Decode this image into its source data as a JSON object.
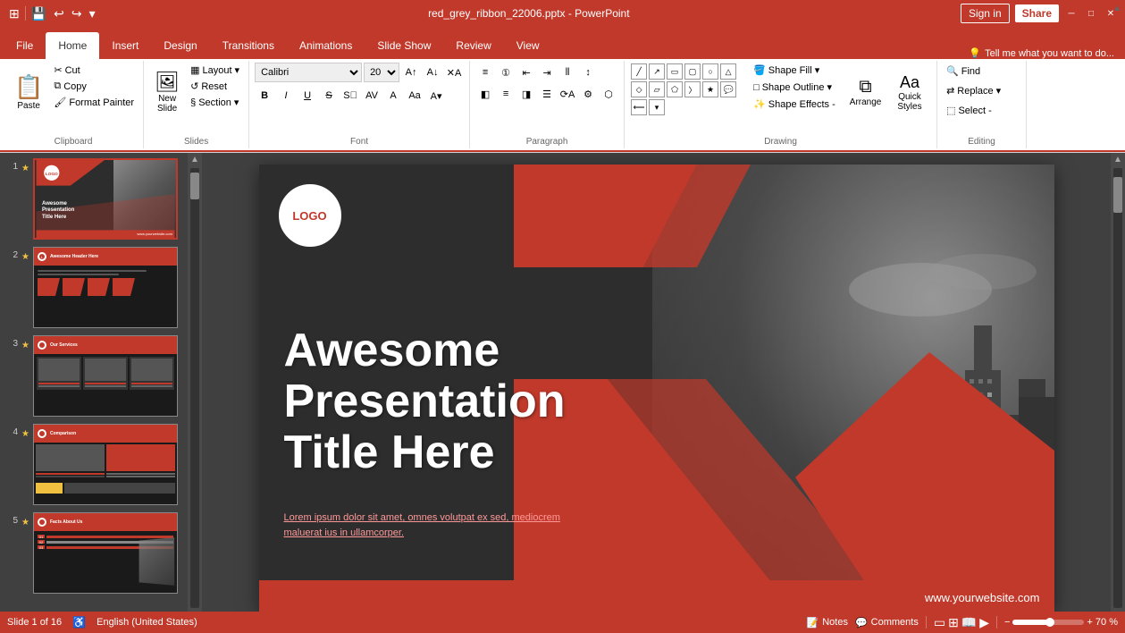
{
  "titlebar": {
    "title": "red_grey_ribbon_22006.pptx - PowerPoint",
    "quick_access": [
      "save",
      "undo",
      "redo",
      "customize"
    ]
  },
  "tabs": [
    {
      "label": "File",
      "active": false
    },
    {
      "label": "Home",
      "active": true
    },
    {
      "label": "Insert",
      "active": false
    },
    {
      "label": "Design",
      "active": false
    },
    {
      "label": "Transitions",
      "active": false
    },
    {
      "label": "Animations",
      "active": false
    },
    {
      "label": "Slide Show",
      "active": false
    },
    {
      "label": "Review",
      "active": false
    },
    {
      "label": "View",
      "active": false
    }
  ],
  "ribbon": {
    "groups": [
      {
        "name": "Clipboard",
        "label": "Clipboard"
      },
      {
        "name": "Slides",
        "label": "Slides"
      },
      {
        "name": "Font",
        "label": "Font"
      },
      {
        "name": "Paragraph",
        "label": "Paragraph"
      },
      {
        "name": "Drawing",
        "label": "Drawing"
      },
      {
        "name": "Editing",
        "label": "Editing"
      }
    ],
    "clipboard": {
      "paste_label": "Paste",
      "cut_label": "Cut",
      "copy_label": "Copy",
      "format_painter_label": "Format Painter"
    },
    "slides": {
      "new_slide_label": "New\nSlide",
      "layout_label": "Layout",
      "reset_label": "Reset",
      "section_label": "Section"
    },
    "font": {
      "font_name": "Calibri",
      "font_size": "20",
      "bold": "B",
      "italic": "I",
      "underline": "U",
      "strikethrough": "S",
      "clear": "A"
    },
    "drawing": {
      "shape_fill_label": "Shape Fill",
      "shape_outline_label": "Shape Outline",
      "shape_effects_label": "Shape Effects -",
      "arrange_label": "Arrange",
      "quick_styles_label": "Quick\nStyles"
    },
    "editing": {
      "find_label": "Find",
      "replace_label": "Replace",
      "select_label": "Select -"
    }
  },
  "slides": [
    {
      "num": "1",
      "active": true,
      "starred": true,
      "title": "Awesome Presentation Title Here"
    },
    {
      "num": "2",
      "active": false,
      "starred": true,
      "header": "Awesome Header Here"
    },
    {
      "num": "3",
      "active": false,
      "starred": true,
      "header": "Our Services"
    },
    {
      "num": "4",
      "active": false,
      "starred": true,
      "header": "Comparison"
    },
    {
      "num": "5",
      "active": false,
      "starred": true,
      "header": "Facts About Us"
    }
  ],
  "main_slide": {
    "logo": "LOGO",
    "title_line1": "Awesome",
    "title_line2": "Presentation",
    "title_line3": "Title Here",
    "subtitle": "Lorem ipsum dolor sit amet, omnes volutpat ex sed, mediocrem\nmaluerat ius in ullamcorper.",
    "website": "www.yourwebsite.com"
  },
  "status_bar": {
    "slide_info": "Slide 1 of 16",
    "language": "English (United States)",
    "notes_label": "Notes",
    "comments_label": "Comments",
    "zoom": "70 %"
  },
  "tell_me": "Tell me what you want to do...",
  "sign_in": "Sign in",
  "share": "Share"
}
